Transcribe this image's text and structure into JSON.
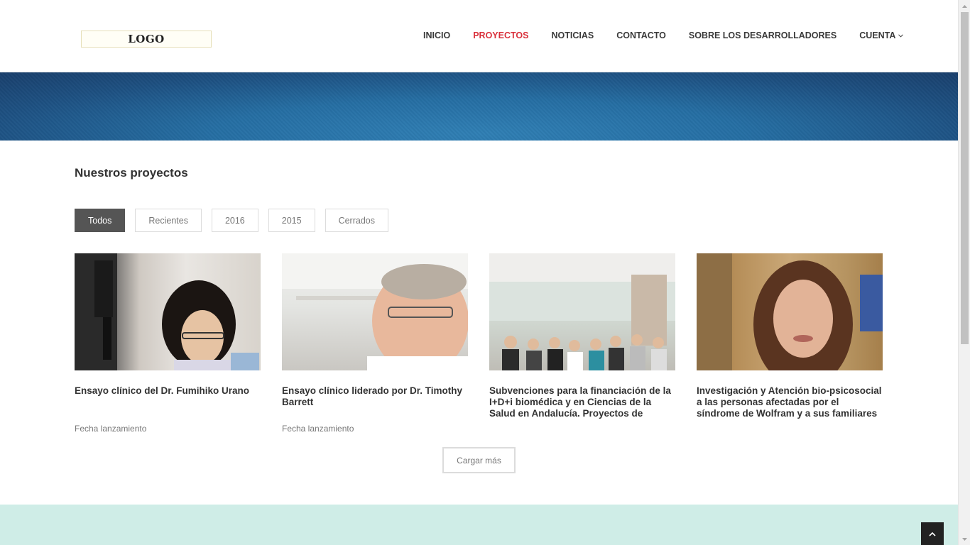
{
  "header": {
    "logo_text": "LOGO",
    "nav": [
      {
        "label": "INICIO",
        "active": false
      },
      {
        "label": "PROYECTOS",
        "active": true
      },
      {
        "label": "NOTICIAS",
        "active": false
      },
      {
        "label": "CONTACTO",
        "active": false
      },
      {
        "label": "SOBRE LOS DESARROLLADORES",
        "active": false
      },
      {
        "label": "CUENTA",
        "active": false,
        "dropdown": true
      }
    ]
  },
  "section": {
    "title": "Nuestros proyectos",
    "filters": [
      {
        "label": "Todos",
        "active": true
      },
      {
        "label": "Recientes",
        "active": false
      },
      {
        "label": "2016",
        "active": false
      },
      {
        "label": "2015",
        "active": false
      },
      {
        "label": "Cerrados",
        "active": false
      }
    ]
  },
  "projects": [
    {
      "title": "Ensayo clínico del Dr. Fumihiko Urano",
      "subtitle": "Fecha lanzamiento"
    },
    {
      "title": "Ensayo clínico liderado por Dr. Timothy Barrett",
      "subtitle": "Fecha lanzamiento"
    },
    {
      "title": "Subvenciones para la financiación de la I+D+i biomédica y en Ciencias de la Salud en Andalucía. Proyectos de Investigación en Salud",
      "subtitle": ""
    },
    {
      "title": "Investigación y Atención bio-psicosocial a las personas afectadas por el síndrome de Wolfram y a sus familiares",
      "subtitle": ""
    }
  ],
  "load_more_label": "Cargar más",
  "colors": {
    "accent": "#d9303b",
    "banner": "#256ea3",
    "footer_band": "#cfede7",
    "active_filter": "#555555"
  },
  "icons": {
    "nav_dropdown": "chevron-down-icon",
    "back_to_top": "chevron-up-icon"
  }
}
